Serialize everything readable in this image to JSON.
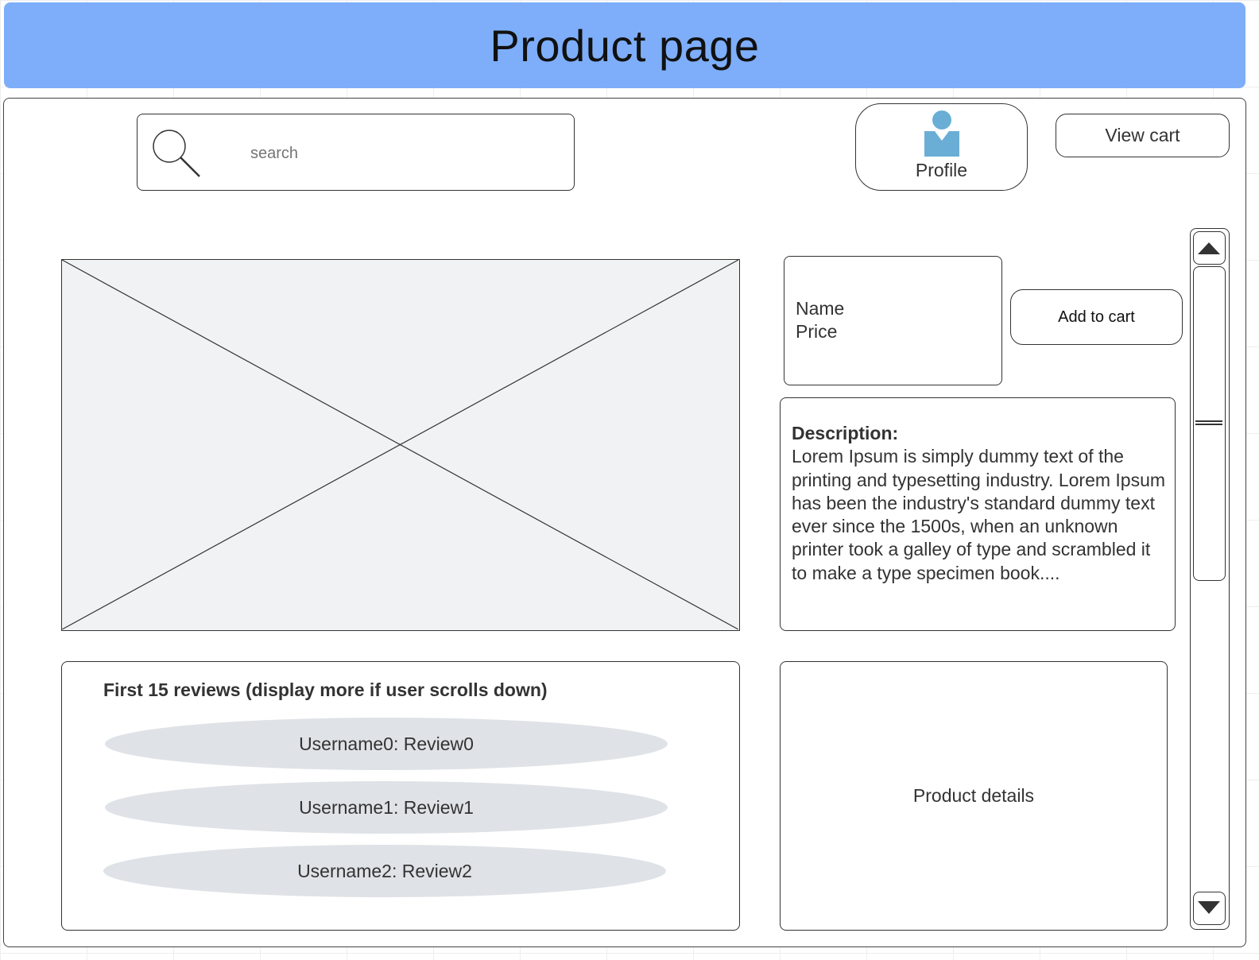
{
  "header": {
    "title": "Product page"
  },
  "search": {
    "placeholder": "search",
    "icon": "search-icon"
  },
  "profile": {
    "label": "Profile",
    "icon": "user-icon",
    "icon_color": "#6aaed6"
  },
  "cart": {
    "view_label": "View cart",
    "add_label": "Add to cart"
  },
  "product": {
    "name_label": "Name",
    "price_label": "Price",
    "description_heading": "Description:",
    "description_text": "Lorem Ipsum is simply dummy text of the printing and typesetting industry. Lorem Ipsum has been the industry's standard dummy text ever since the 1500s, when an unknown printer took a galley of type and scrambled it to make a type specimen book....",
    "details_label": "Product details"
  },
  "reviews": {
    "heading": "First 15 reviews (display more if user scrolls down)",
    "items": [
      {
        "text": "Username0: Review0"
      },
      {
        "text": "Username1: Review1"
      },
      {
        "text": "Username2: Review2"
      }
    ]
  },
  "colors": {
    "header_bg": "#7eaefa",
    "image_placeholder_bg": "#f1f2f4",
    "review_pill_bg": "#dfe2e6"
  }
}
